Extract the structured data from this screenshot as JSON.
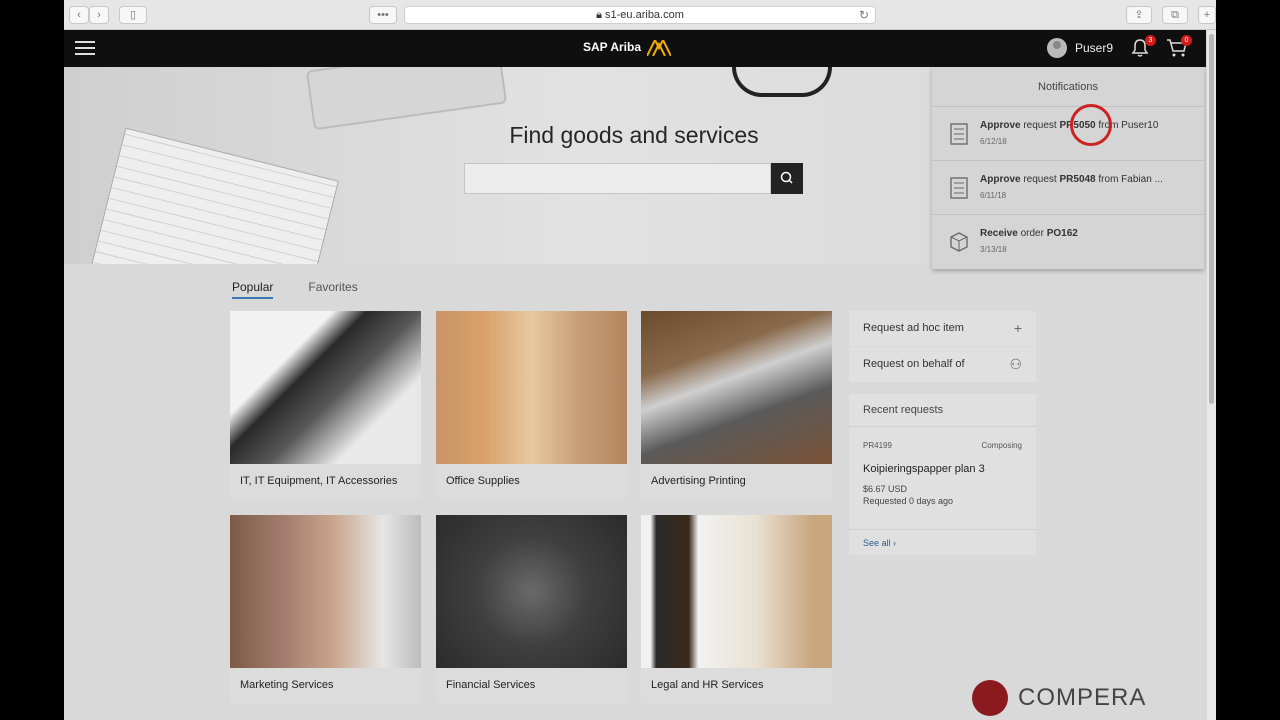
{
  "browser": {
    "url": "s1-eu.ariba.com",
    "back_glyph": "‹",
    "forward_glyph": "›",
    "sidebar_glyph": "▯",
    "dots_glyph": "•••",
    "reload_glyph": "↻",
    "share_glyph": "⇪",
    "tabs_glyph": "⧉",
    "newtab_glyph": "+"
  },
  "header": {
    "logo_text": "SAP Ariba",
    "user_name": "Puser9",
    "notification_count": "3",
    "cart_count": "0"
  },
  "hero": {
    "title": "Find goods and services",
    "search_placeholder": ""
  },
  "notifications": {
    "title": "Notifications",
    "items": [
      {
        "action": "Approve",
        "mid": " request ",
        "ref": "PR5050",
        "tail": " from Puser10",
        "date": "6/12/18",
        "icon": "checklist-icon"
      },
      {
        "action": "Approve",
        "mid": " request ",
        "ref": "PR5048",
        "tail": " from Fabian ...",
        "date": "6/11/18",
        "icon": "checklist-icon"
      },
      {
        "action": "Receive",
        "mid": " order ",
        "ref": "PO162",
        "tail": "",
        "date": "3/13/18",
        "icon": "box-icon"
      }
    ]
  },
  "tabs": [
    {
      "label": "Popular"
    },
    {
      "label": "Favorites"
    }
  ],
  "categories": [
    {
      "label": "IT, IT Equipment, IT Accessories"
    },
    {
      "label": "Office Supplies"
    },
    {
      "label": "Advertising Printing"
    },
    {
      "label": "Marketing Services"
    },
    {
      "label": "Financial Services"
    },
    {
      "label": "Legal and HR Services"
    }
  ],
  "side_actions": [
    {
      "label": "Request ad hoc item",
      "icon_glyph": "+"
    },
    {
      "label": "Request on behalf of",
      "icon_glyph": "⚇"
    }
  ],
  "recent": {
    "title": "Recent requests",
    "id": "PR4199",
    "status": "Composing",
    "name": "Koipieringspapper plan 3",
    "amount": "$6.67 USD",
    "requested": "Requested 0 days ago",
    "see_all": "See all",
    "see_all_glyph": "›"
  },
  "watermark": {
    "text": "COMPERA"
  },
  "colors": {
    "accent": "#3a79b5",
    "badge": "#d31a1a",
    "header_bg": "#0f0f0f",
    "compera": "#8a1a1d"
  }
}
